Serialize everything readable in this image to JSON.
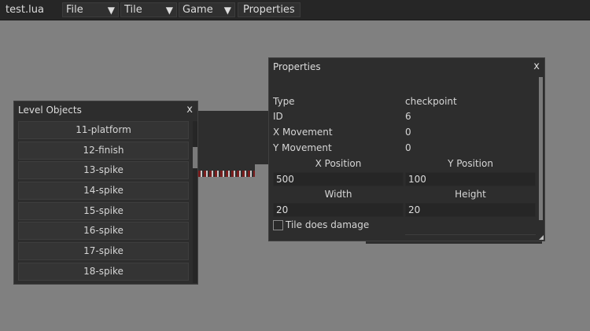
{
  "menubar": {
    "app_title": "test.lua",
    "menus": [
      {
        "label": "File",
        "arrow": "▼"
      },
      {
        "label": "Tile",
        "arrow": "▼"
      },
      {
        "label": "Game",
        "arrow": "▼"
      }
    ],
    "properties_button": "Properties"
  },
  "level_objects": {
    "title": "Level Objects",
    "close": "x",
    "items": [
      "11-platform",
      "12-finish",
      "13-spike",
      "14-spike",
      "15-spike",
      "16-spike",
      "17-spike",
      "18-spike"
    ]
  },
  "properties": {
    "title": "Properties",
    "close": "x",
    "rows": [
      {
        "label": "Type",
        "value": "checkpoint"
      },
      {
        "label": "ID",
        "value": "6"
      },
      {
        "label": "X Movement",
        "value": "0"
      },
      {
        "label": "Y Movement",
        "value": "0"
      }
    ],
    "x_position_label": "X Position",
    "y_position_label": "Y Position",
    "x_position_value": "500",
    "y_position_value": "100",
    "width_label": "Width",
    "height_label": "Height",
    "width_value": "20",
    "height_value": "20",
    "damage_checkbox_label": "Tile does damage",
    "damage_checked": false
  }
}
